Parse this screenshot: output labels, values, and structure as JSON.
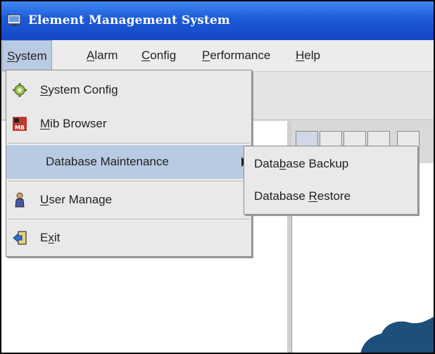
{
  "window": {
    "title": "Element Management System"
  },
  "menubar": {
    "items": [
      {
        "pre": "",
        "mn": "S",
        "post": "ystem"
      },
      {
        "pre": "",
        "mn": "A",
        "post": "larm"
      },
      {
        "pre": "",
        "mn": "C",
        "post": "onfig"
      },
      {
        "pre": "",
        "mn": "P",
        "post": "erformance"
      },
      {
        "pre": "",
        "mn": "H",
        "post": "elp"
      }
    ]
  },
  "system_menu": {
    "system_config": {
      "pre": "",
      "mn": "S",
      "post": "ystem Config"
    },
    "mib_browser": {
      "pre": "",
      "mn": "M",
      "post": "ib Browser"
    },
    "db_maintenance": {
      "label": "Database  Maintenance"
    },
    "user_manage": {
      "pre": "",
      "mn": "U",
      "post": "ser Manage"
    },
    "exit": {
      "pre": "E",
      "mn": "x",
      "post": "it"
    }
  },
  "db_submenu": {
    "backup": {
      "pre": "Data",
      "mn": "b",
      "post": "ase Backup"
    },
    "restore": {
      "pre": "Database ",
      "mn": "R",
      "post": "estore"
    }
  },
  "colors": {
    "title_bar": "#1c5ad8",
    "highlight": "#b9cbe2"
  },
  "icons": [
    "window-icon",
    "gear-icon",
    "mib-icon",
    "user-icon",
    "exit-icon",
    "submenu-arrow-icon"
  ]
}
